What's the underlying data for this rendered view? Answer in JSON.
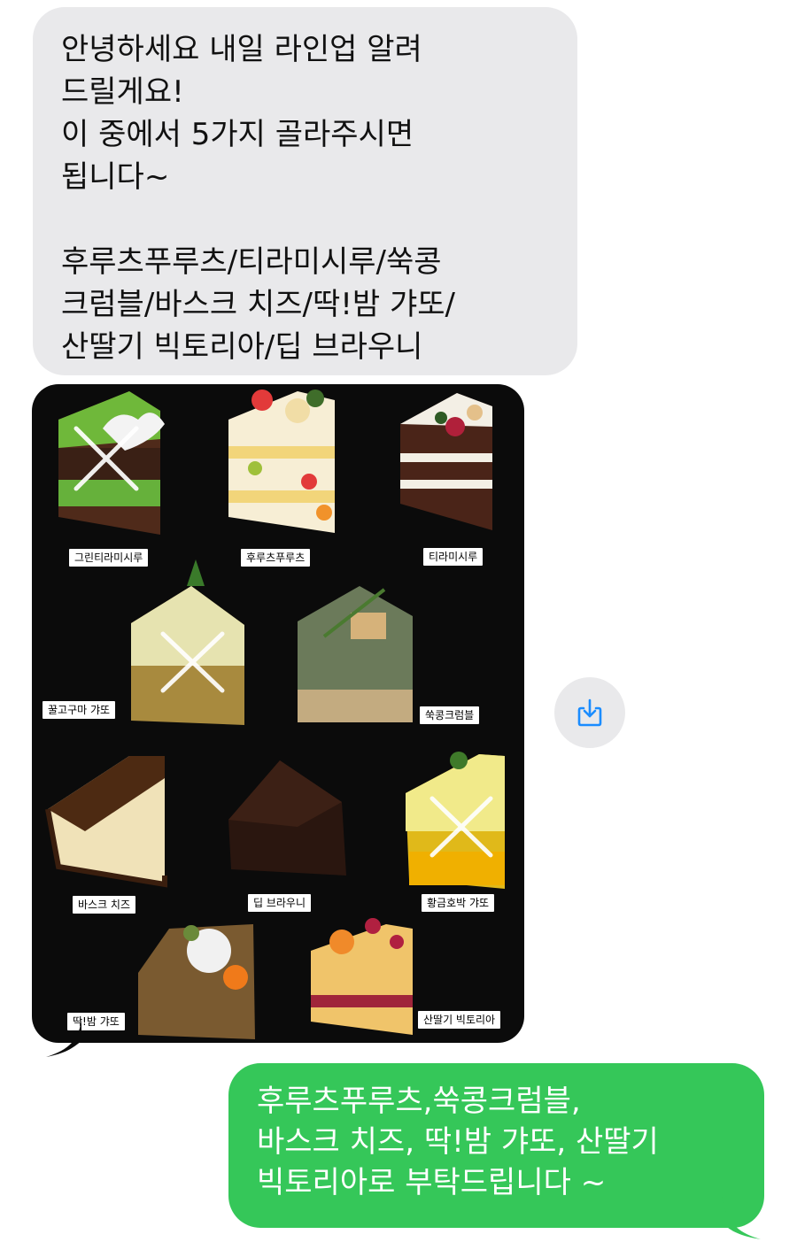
{
  "incoming": {
    "lines": [
      "안녕하세요 내일 라인업 알려",
      "드릴게요!",
      "이 중에서 5가지 골라주시면",
      "됩니다~",
      "후루츠푸루츠/티라미시루/쑥콩",
      "크럼블/바스크 치즈/딱!밤 갸또/",
      "산딸기 빅토리아/딥 브라우니"
    ]
  },
  "menu_image": {
    "labels": {
      "green_tiramisu": "그린티라미시루",
      "fruits": "후루츠푸루츠",
      "tiramisu": "티라미시루",
      "honey_sweetpotato": "꿀고구마 갸또",
      "mugwort_crumble": "쑥콩크럼블",
      "basque": "바스크 치즈",
      "brownie": "딥 브라우니",
      "pumpkin": "황금호박 갸또",
      "chestnut": "딱!밤 갸또",
      "raspberry": "산딸기 빅토리아"
    }
  },
  "outgoing": {
    "lines": [
      "후루츠푸루츠,쑥콩크럼블,",
      "바스크 치즈, 딱!밤 갸또, 산딸기",
      "빅토리아로 부탁드립니다 ~"
    ]
  },
  "colors": {
    "incoming_bubble": "#e9e9eb",
    "outgoing_bubble": "#35c759",
    "download_icon": "#1a8cff"
  },
  "icons": {
    "download": "save-download-icon"
  }
}
